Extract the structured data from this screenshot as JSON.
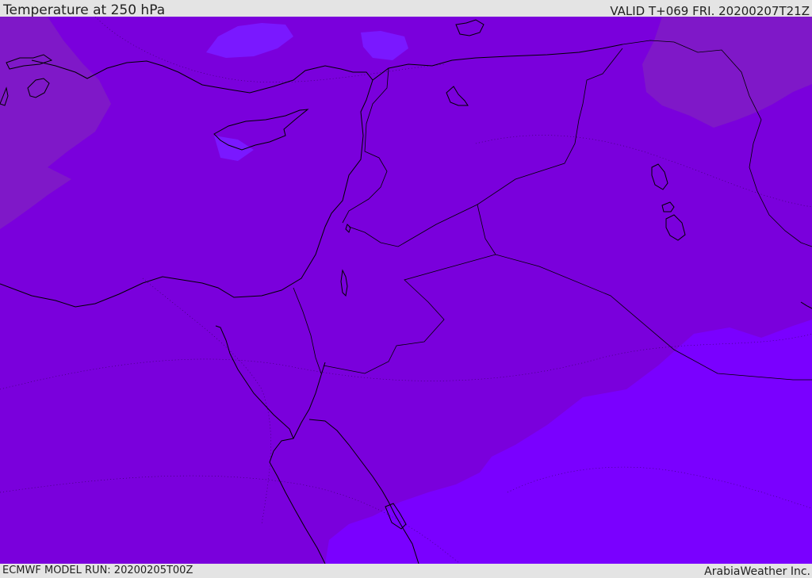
{
  "header": {
    "title": "Temperature at 250 hPa",
    "valid": "VALID T+069 FRI. 20200207T21Z"
  },
  "footer": {
    "model_run": "ECMWF MODEL RUN: 20200205T00Z",
    "credit": "ArabiaWeather Inc."
  },
  "colors": {
    "base_field": "#7a00dc",
    "cold_region": "#7a00ff",
    "warm_region": "#7f18c8",
    "cold_patch": "#7a18ff",
    "coastline": "#000000",
    "header_background": "#e4e4e4"
  }
}
